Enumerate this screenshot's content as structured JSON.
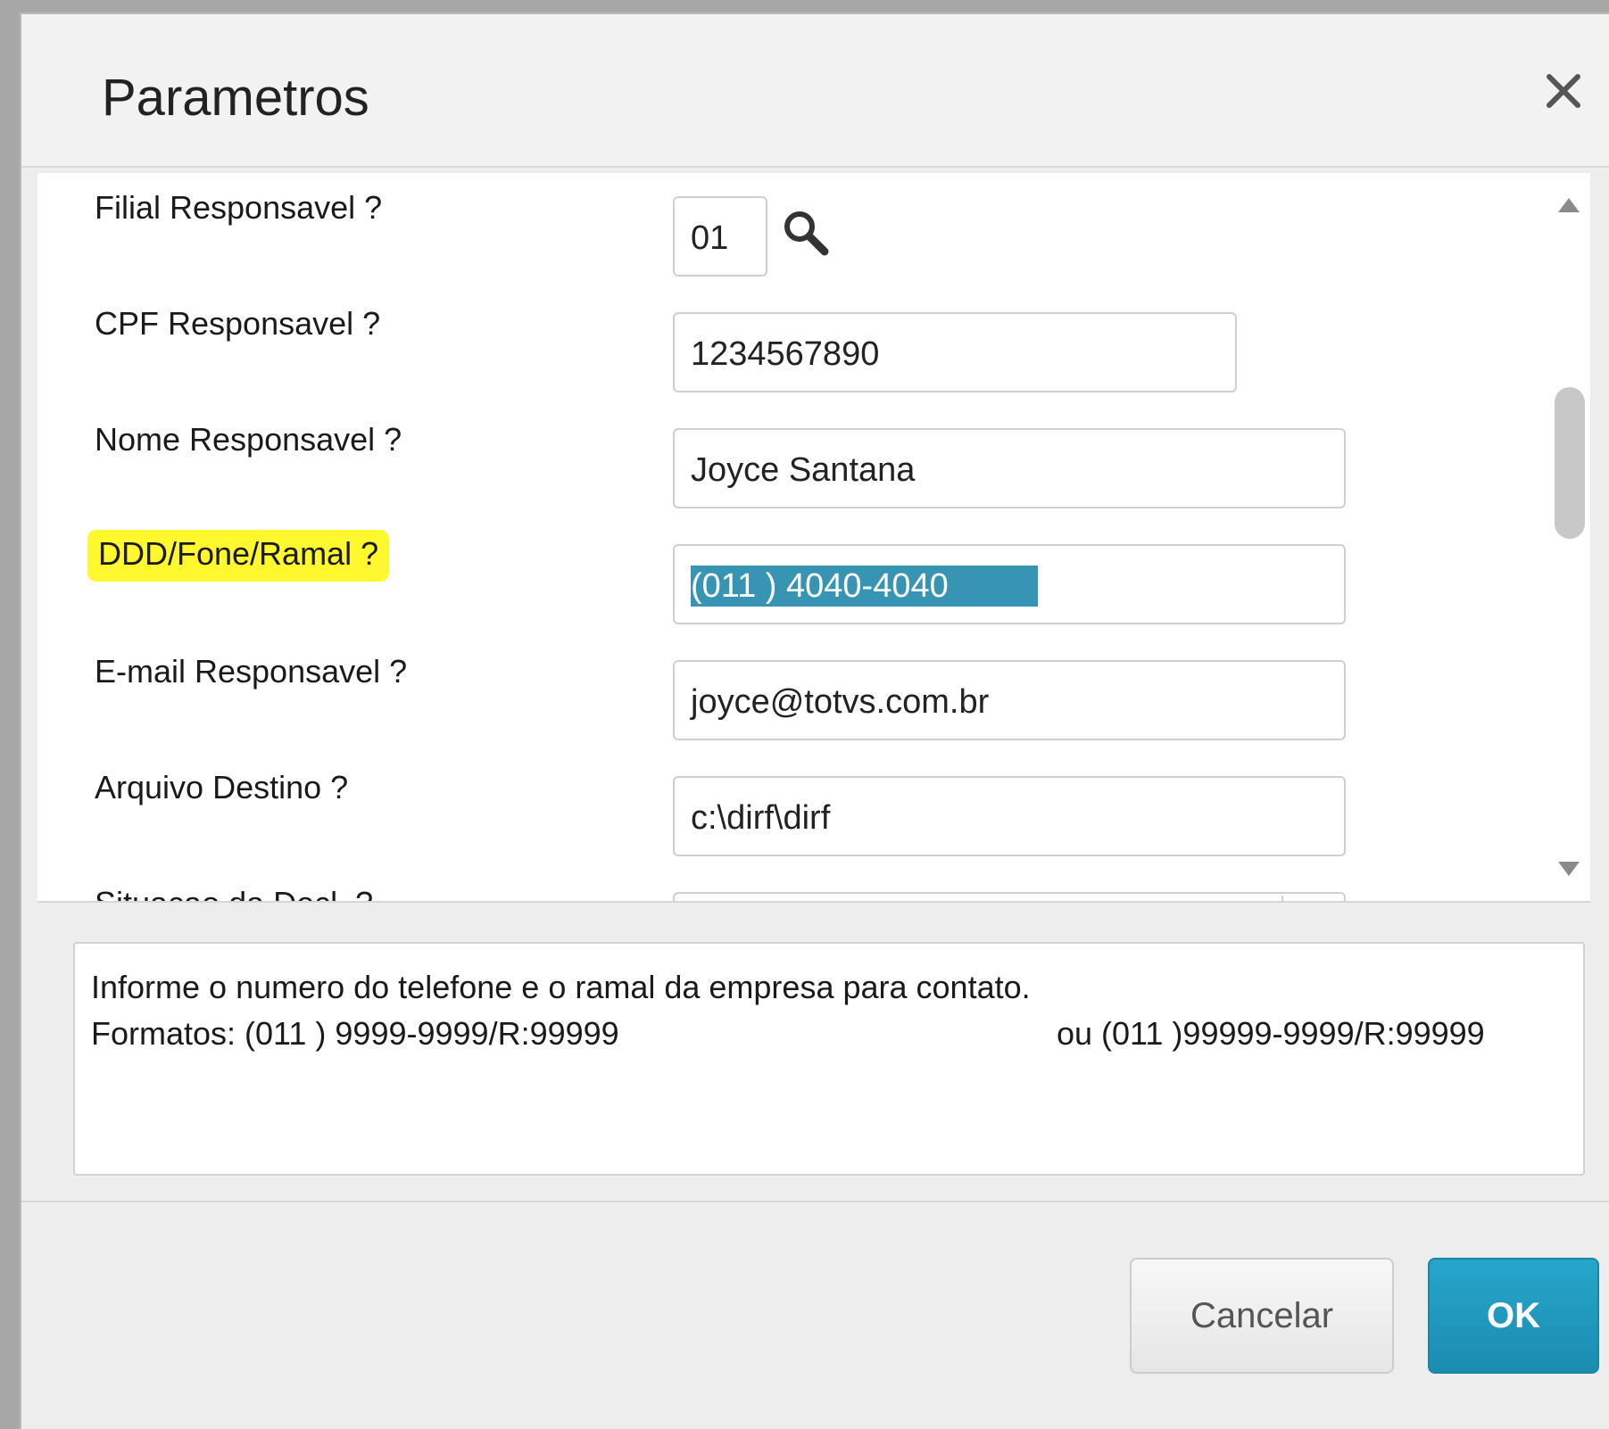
{
  "dialog": {
    "title": "Parametros"
  },
  "form": {
    "fields": [
      {
        "label": "Filial Responsavel ?",
        "value": "01"
      },
      {
        "label": "CPF Responsavel ?",
        "value": "1234567890"
      },
      {
        "label": "Nome Responsavel ?",
        "value": "Joyce Santana"
      },
      {
        "label": "DDD/Fone/Ramal ?",
        "value": "(011 ) 4040-4040"
      },
      {
        "label": "E-mail Responsavel ?",
        "value": "joyce@totvs.com.br"
      },
      {
        "label": "Arquivo Destino ?",
        "value": "c:\\dirf\\dirf"
      },
      {
        "label": "Situacao da Decl. ?",
        "value": ""
      }
    ]
  },
  "help": {
    "line1": "Informe o numero do telefone e o ramal da empresa para contato.",
    "line2_left": "Formatos: (011 ) 9999-9999/R:99999",
    "line2_right": "ou (011 )99999-9999/R:99999"
  },
  "buttons": {
    "cancel": "Cancelar",
    "ok": "OK"
  },
  "colors": {
    "highlight": "#fff82e",
    "selection": "#3795b3",
    "ok_button": "#1f99c0"
  },
  "icons": {
    "close": "close-icon",
    "lookup": "search-icon",
    "scroll_up": "arrow-up-icon",
    "scroll_down": "arrow-down-icon"
  }
}
